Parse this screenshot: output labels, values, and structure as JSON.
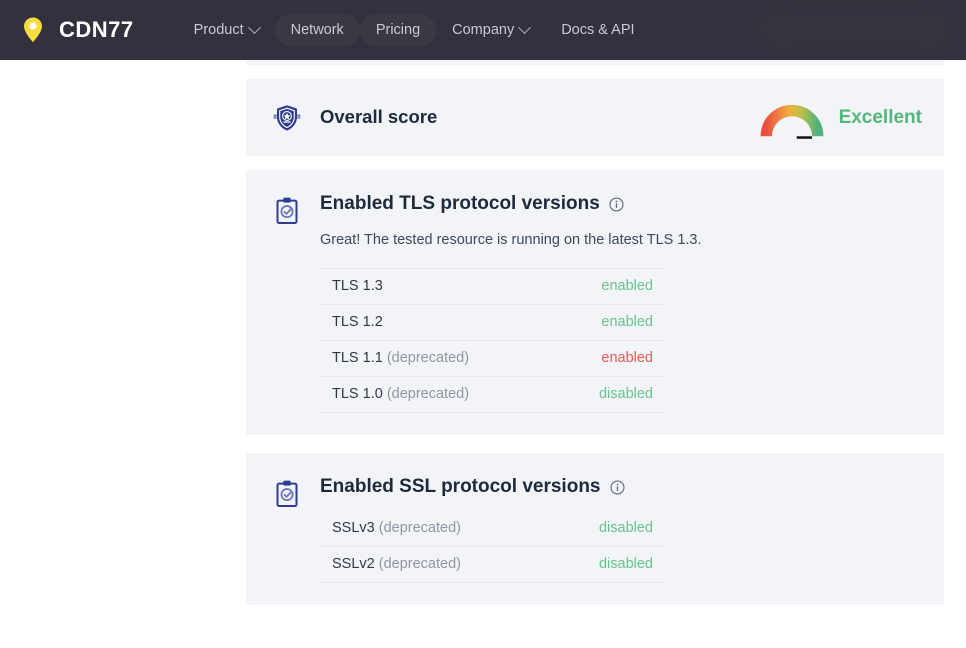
{
  "nav": {
    "brand": "CDN77",
    "brand_icon": "location-pin-icon",
    "items": [
      {
        "label": "Product",
        "has_chevron": true,
        "highlighted": false
      },
      {
        "label": "Network",
        "has_chevron": false,
        "highlighted": true
      },
      {
        "label": "Pricing",
        "has_chevron": false,
        "highlighted": true
      },
      {
        "label": "Company",
        "has_chevron": true,
        "highlighted": false
      },
      {
        "label": "Docs & API",
        "has_chevron": false,
        "highlighted": false
      }
    ]
  },
  "overall": {
    "icon": "shield-star-badge-icon",
    "title": "Overall score",
    "verdict": "Excellent",
    "verdict_color": "#52b87a",
    "gauge": {
      "needle_position": "green-zone",
      "colors": [
        "#e8513f",
        "#ef8540",
        "#f0ac3e",
        "#c9c44a",
        "#57b877"
      ]
    }
  },
  "tls": {
    "icon": "clipboard-check-icon",
    "title": "Enabled TLS protocol versions",
    "info_icon": "info-circle-icon",
    "description": "Great! The tested resource is running on the latest TLS 1.3.",
    "rows": [
      {
        "name": "TLS 1.3",
        "note": "",
        "state": "enabled",
        "state_kind": "enabled-ok"
      },
      {
        "name": "TLS 1.2",
        "note": "",
        "state": "enabled",
        "state_kind": "enabled-ok"
      },
      {
        "name": "TLS 1.1",
        "note": "(deprecated)",
        "state": "enabled",
        "state_kind": "enabled-bad"
      },
      {
        "name": "TLS 1.0",
        "note": "(deprecated)",
        "state": "disabled",
        "state_kind": "disabled-ok"
      }
    ]
  },
  "ssl": {
    "icon": "clipboard-check-icon",
    "title": "Enabled SSL protocol versions",
    "info_icon": "info-circle-icon",
    "rows": [
      {
        "name": "SSLv3",
        "note": "(deprecated)",
        "state": "disabled",
        "state_kind": "disabled-ok"
      },
      {
        "name": "SSLv2",
        "note": "(deprecated)",
        "state": "disabled",
        "state_kind": "disabled-ok"
      }
    ]
  },
  "colors": {
    "nav_bg": "#32313d",
    "card_bg": "#f3f4f8",
    "page_bg": "#ffffff",
    "brand_yellow": "#f7dd3f",
    "heading": "#1d2a3b",
    "icon_blue": "#2e3d91",
    "green": "#68c48c",
    "red": "#e45c55"
  }
}
